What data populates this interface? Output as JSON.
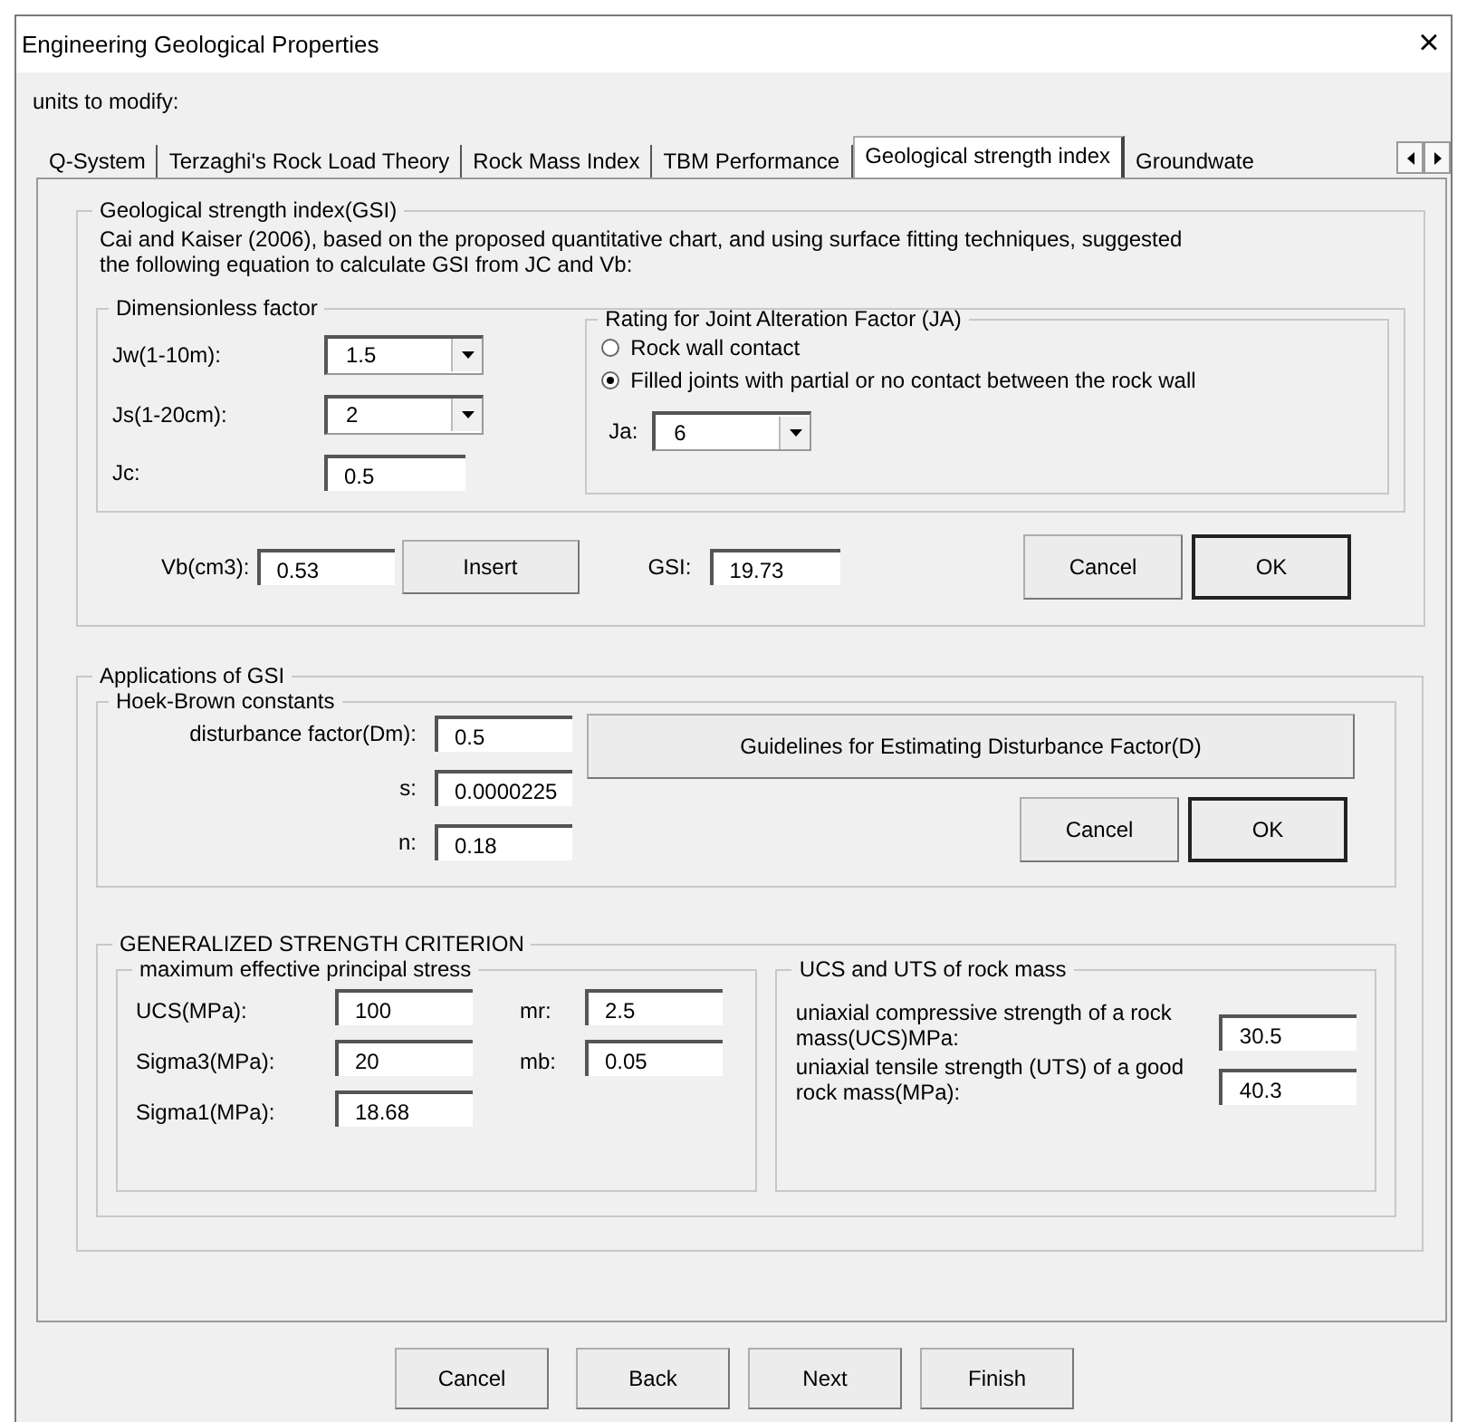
{
  "window": {
    "title": "Engineering Geological Properties",
    "close": "×"
  },
  "units_label": "units to modify:",
  "tabs": [
    {
      "label": "Q-System",
      "selected": false
    },
    {
      "label": "Terzaghi's Rock Load Theory",
      "selected": false
    },
    {
      "label": "Rock Mass Index",
      "selected": false
    },
    {
      "label": "TBM Performance",
      "selected": false
    },
    {
      "label": "Geological strength index",
      "selected": true
    },
    {
      "label": "Groundwate",
      "selected": false
    }
  ],
  "gsi": {
    "title": "Geological strength index(GSI)",
    "description": "Cai and Kaiser (2006), based on the proposed quantitative chart, and using surface fitting techniques, suggested\n the following equation to calculate GSI from JC and Vb:",
    "dimensionless": {
      "title": "Dimensionless factor",
      "fields": [
        {
          "label": "Jw(1-10m):",
          "value": "1.5",
          "kind": "combo"
        },
        {
          "label": "Js(1-20cm):",
          "value": "2",
          "kind": "combo"
        },
        {
          "label": "Jc:",
          "value": "0.5",
          "kind": "text"
        }
      ]
    },
    "ja": {
      "title": "Rating for Joint Alteration Factor (JA)",
      "options": [
        {
          "label": "Rock wall contact",
          "selected": false
        },
        {
          "label": "Filled joints with partial or no contact between the rock wall",
          "selected": true
        }
      ],
      "field": {
        "label": "Ja:",
        "value": "6",
        "kind": "combo"
      }
    },
    "vb": {
      "label": "Vb(cm3):",
      "value": "0.53"
    },
    "insert": "Insert",
    "result": {
      "label": "GSI:",
      "value": "19.73"
    },
    "buttons": [
      {
        "label": "Cancel",
        "default": false
      },
      {
        "label": "OK",
        "default": true
      }
    ]
  },
  "applications": {
    "title": "Applications of GSI",
    "hoek_brown": {
      "title": "Hoek-Brown constants",
      "fields": [
        {
          "label": "disturbance factor(Dm):",
          "value": "0.5"
        },
        {
          "label": "s:",
          "value": "0.0000225"
        },
        {
          "label": "n:",
          "value": "0.18"
        }
      ],
      "guidelines": "Guidelines for Estimating Disturbance Factor(D)",
      "buttons": [
        {
          "label": "Cancel",
          "default": false
        },
        {
          "label": "OK",
          "default": true
        }
      ]
    },
    "criterion": {
      "title": "GENERALIZED STRENGTH CRITERION",
      "stress": {
        "title": "maximum effective principal stress",
        "fields": [
          {
            "label": "UCS(MPa):",
            "value": "100"
          },
          {
            "label": "mr:",
            "value": "2.5"
          },
          {
            "label": "Sigma3(MPa):",
            "value": "20"
          },
          {
            "label": "mb:",
            "value": "0.05"
          },
          {
            "label": "Sigma1(MPa):",
            "value": "18.68"
          }
        ]
      },
      "rock_mass": {
        "title": "UCS and UTS of rock mass",
        "fields": [
          {
            "label": "uniaxial compressive strength of a rock mass(UCS)MPa:",
            "value": "30.5"
          },
          {
            "label": "uniaxial tensile strength (UTS) of a good rock mass(MPa):",
            "value": "40.3"
          }
        ]
      }
    }
  },
  "footer_buttons": [
    "Cancel",
    "Back",
    "Next",
    "Finish"
  ]
}
